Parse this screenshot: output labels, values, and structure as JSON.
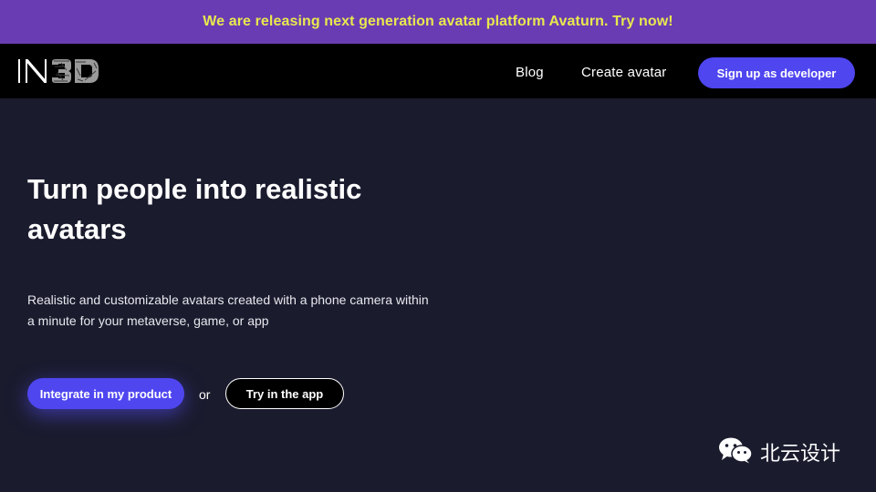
{
  "banner": {
    "text": "We are releasing next generation avatar platform Avaturn. Try now!"
  },
  "nav": {
    "logo_text": "IN3D",
    "links": [
      {
        "label": "Blog"
      },
      {
        "label": "Create avatar"
      }
    ],
    "cta_label": "Sign up as developer"
  },
  "hero": {
    "title": "Turn people into realistic avatars",
    "subtitle": "Realistic and customizable avatars created with a phone camera within a minute for your metaverse, game, or app",
    "primary_cta": "Integrate in my product",
    "or_text": "or",
    "secondary_cta": "Try in the app"
  },
  "watermark": {
    "text": "北云设计",
    "icon": "wechat-icon"
  },
  "colors": {
    "banner_bg": "#6a3cb3",
    "banner_text": "#e6e94e",
    "nav_bg": "#000000",
    "page_bg": "#1a1b2d",
    "accent": "#4f46f0",
    "text": "#ffffff"
  }
}
